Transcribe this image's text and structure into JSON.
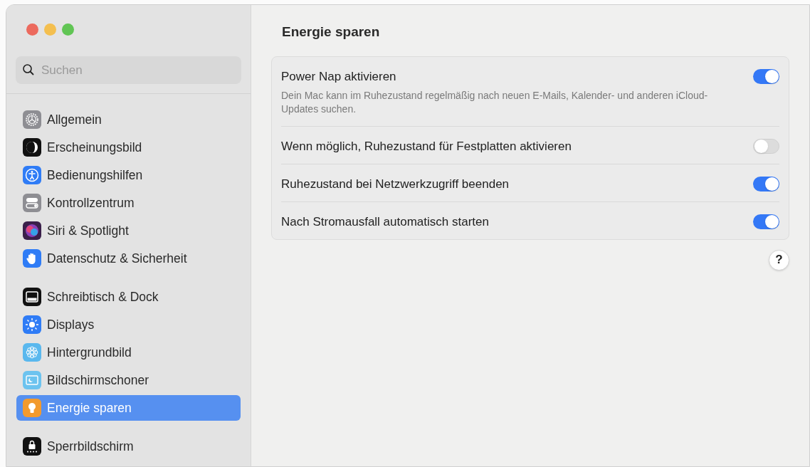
{
  "window": {
    "controls": [
      {
        "color": "#ec6a5e"
      },
      {
        "color": "#f4bf4f"
      },
      {
        "color": "#61c554"
      }
    ]
  },
  "search": {
    "placeholder": "Suchen"
  },
  "sidebar": {
    "groups": [
      [
        {
          "label": "Allgemein",
          "selected": false
        },
        {
          "label": "Erscheinungsbild",
          "selected": false
        },
        {
          "label": "Bedienungshilfen",
          "selected": false
        },
        {
          "label": "Kontrollzentrum",
          "selected": false
        },
        {
          "label": "Siri & Spotlight",
          "selected": false
        },
        {
          "label": "Datenschutz & Sicherheit",
          "selected": false
        }
      ],
      [
        {
          "label": "Schreibtisch & Dock",
          "selected": false
        },
        {
          "label": "Displays",
          "selected": false
        },
        {
          "label": "Hintergrundbild",
          "selected": false
        },
        {
          "label": "Bildschirmschoner",
          "selected": false
        },
        {
          "label": "Energie sparen",
          "selected": true
        }
      ],
      [
        {
          "label": "Sperrbildschirm",
          "selected": false
        }
      ]
    ]
  },
  "title": "Energie sparen",
  "settings": [
    {
      "label": "Power Nap aktivieren",
      "description": "Dein Mac kann im Ruhezustand regelmäßig nach neuen E-Mails, Kalender- und anderen iCloud-Updates suchen.",
      "on": true
    },
    {
      "label": "Wenn möglich, Ruhezustand für Festplatten aktivieren",
      "on": false
    },
    {
      "label": "Ruhezustand bei Netzwerkzugriff beenden",
      "on": true
    },
    {
      "label": "Nach Stromausfall automatisch starten",
      "on": true
    }
  ],
  "help": {
    "label": "?"
  }
}
